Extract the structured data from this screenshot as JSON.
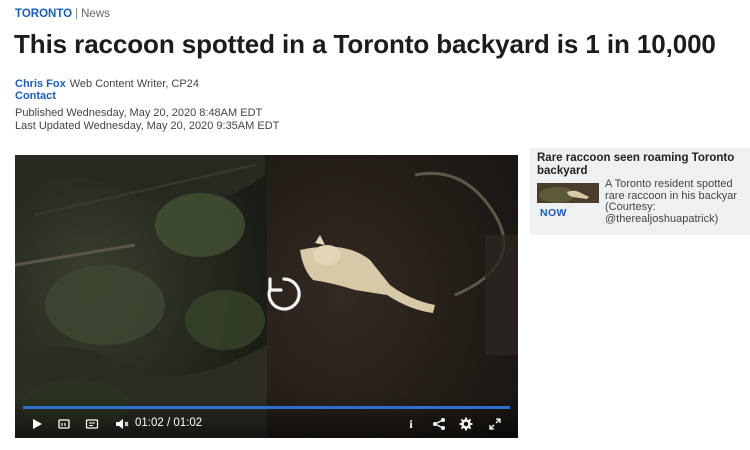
{
  "breadcrumb": {
    "section": "TORONTO",
    "separator": "|",
    "subsection": "News"
  },
  "article": {
    "headline": "This raccoon spotted in a Toronto backyard is 1 in 10,000",
    "author": "Chris Fox",
    "author_role": "Web Content Writer, CP24",
    "contact": "Contact",
    "published": "Published Wednesday, May 20, 2020 8:48AM EDT",
    "updated": "Last Updated Wednesday, May 20, 2020 9:35AM EDT"
  },
  "video": {
    "current_time": "01:02",
    "time_separator": "/",
    "duration": "01:02",
    "progress": 1.0,
    "icons": [
      "play-icon",
      "replay-10-icon",
      "captions-icon",
      "mute-icon",
      "info-icon",
      "share-icon",
      "settings-icon",
      "fullscreen-icon",
      "replay-icon"
    ],
    "info_label": "i"
  },
  "related": {
    "title": "Rare raccoon seen roaming Toronto backyard",
    "badge": "NOW",
    "desc_line1": "A Toronto resident spotted",
    "desc_line2": "rare raccoon in his backyar",
    "desc_line3": "(Courtesy:",
    "desc_line4": "@therealjoshuapatrick)"
  },
  "colors": {
    "link_blue": "#1a5fb4",
    "progress_blue": "#2f6fd0",
    "sidebar_bg": "#eef0f2"
  }
}
